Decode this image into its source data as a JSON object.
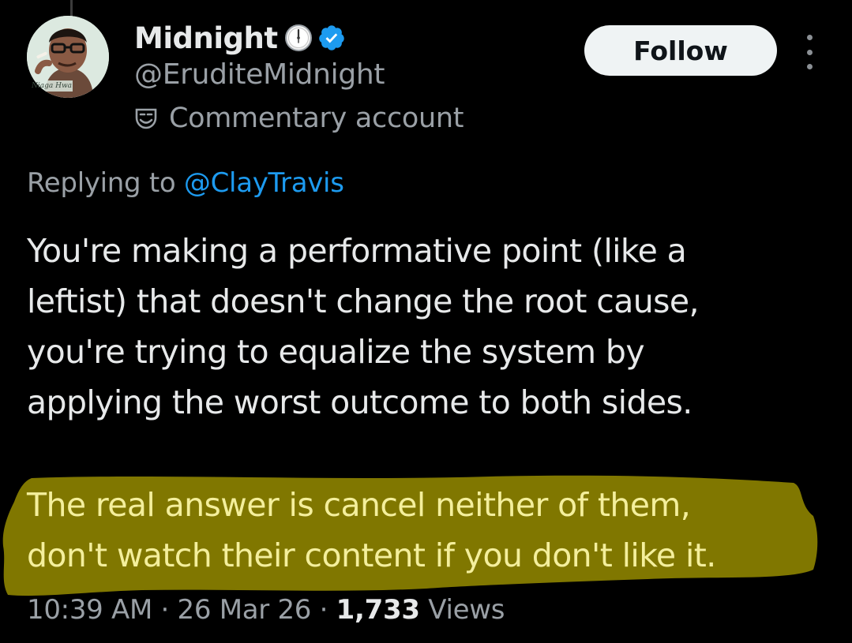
{
  "tweet": {
    "author": {
      "display_name": "Midnight",
      "handle": "@EruditeMidnight",
      "account_label": "Commentary account",
      "avatar_caption": "Niaga Hwa"
    },
    "follow_label": "Follow",
    "reply_prefix": "Replying to",
    "reply_to": "@ClayTravis",
    "paragraphs": [
      "You're making a performative point (like a",
      "leftist) that doesn't change the root cause,",
      "you're trying to equalize the system by",
      "applying the worst outcome to both sides."
    ],
    "highlighted_paragraphs": [
      "The real answer is cancel neither of them,",
      "don't watch their content if you don't like it."
    ],
    "time": "10:39 AM",
    "separator": "·",
    "date": "26 Mar 26",
    "views_count": "1,733",
    "views_label": "Views"
  },
  "colors": {
    "background": "#000000",
    "primary_text": "#e7e9ea",
    "secondary_text": "#9aa0a6",
    "link": "#1d9bf0",
    "verified_badge": "#1d9bf0",
    "highlight_marker": "#807700",
    "highlighted_text": "#f4ef9c",
    "follow_button_bg": "#eff3f4"
  },
  "icons": {
    "clock": "clock-emoji-icon",
    "verified": "verified-badge-icon",
    "label": "theater-mask-icon",
    "more": "more-vertical-icon"
  }
}
